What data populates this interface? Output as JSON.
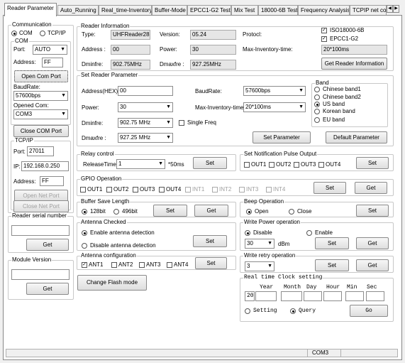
{
  "tabs": [
    "Reader Parameter",
    "Auto_Running",
    "Real_time-Inventory",
    "Buffer-Mode",
    "EPCC1-G2 Test",
    "Mix Test",
    "18000-6B Test",
    "Frequency Analysis",
    "TCPIP net co"
  ],
  "communication": {
    "title": "Communication",
    "com": "COM",
    "tcpip": "TCP/IP",
    "com_group": "COM",
    "port_label": "Port:",
    "port_value": "AUTO",
    "address_label": "Address:",
    "address_value": "FF",
    "open_com_port": "Open Com Port",
    "baudrate_label": "BaudRate:",
    "baudrate_value": "57600bps",
    "opened_com_label": "Opened Com:",
    "opened_com_value": "COM3",
    "close_com_port": "Close COM Port",
    "tcpip_group": "TCP/IP",
    "tport_label": "Port:",
    "tport_value": "27011",
    "ip_label": "IP:",
    "ip_value": "192.168.0.250",
    "taddress_label": "Address:",
    "taddress_value": "FF",
    "open_net_port": "Open Net Port",
    "close_net_port": "Close Net Port"
  },
  "serial": {
    "title": "Reader serial number",
    "get": "Get"
  },
  "module": {
    "title": "Module Version",
    "get": "Get"
  },
  "info": {
    "title": "Reader Information",
    "type_label": "Type:",
    "type_value": "UHFReader288",
    "version_label": "Version:",
    "version_value": "05.24",
    "protocol_label": "Protocl:",
    "iso_label": "ISO18000-6B",
    "epc_label": "EPCC1-G2",
    "address_label": "Address :",
    "address_value": "00",
    "power_label": "Power:",
    "power_value": "30",
    "maxinv_label": "Max-Inventory-time:",
    "maxinv_value": "20*100ms",
    "dminfre_label": "Dminfre:",
    "dminfre_value": "902.75MHz",
    "dmaxfre_label": "Dmaxfre :",
    "dmaxfre_value": "927.25MHz",
    "get_info": "Get Reader Information"
  },
  "setparam": {
    "title": "Set Reader Parameter",
    "address_label": "Address(HEX):",
    "address_value": "00",
    "baud_label": "BaudRate:",
    "baud_value": "57600bps",
    "power_label": "Power:",
    "power_value": "30",
    "maxinv_label": "Max-Inventory-time:",
    "maxinv_value": "20*100ms",
    "dminfre_label": "Dminfre:",
    "dminfre_value": "902.75 MHz",
    "single_freq": "Single Freq",
    "dmaxfre_label": "Dmaxfre :",
    "dmaxfre_value": "927.25 MHz",
    "set_param": "Set Parameter",
    "default_param": "Default Parameter",
    "band_title": "Band",
    "bands": [
      "Chinese band1",
      "Chinese band2",
      "US band",
      "Korean band",
      "EU band"
    ]
  },
  "relay": {
    "title": "Relay control",
    "label": "ReleaseTime",
    "value": "1",
    "unit": "*50ms",
    "set": "Set"
  },
  "notify": {
    "title": "Set Notification Pulse Output",
    "outs": [
      "OUT1",
      "OUT2",
      "OUT3",
      "OUT4"
    ],
    "set": "Set"
  },
  "gpio": {
    "title": "GPIO Operation",
    "outs": [
      "OUT1",
      "OUT2",
      "OUT3",
      "OUT4"
    ],
    "ints": [
      "INT1",
      "INT2",
      "INT3",
      "INT4"
    ],
    "set": "Set",
    "get": "Get"
  },
  "buffer": {
    "title": "Buffer Save Length",
    "opt1": "128bit",
    "opt2": "496bit",
    "set": "Set",
    "get": "Get"
  },
  "beep": {
    "title": "Beep Operation",
    "open": "Open",
    "close": "Close",
    "set": "Set"
  },
  "antenna_check": {
    "title": "Antenna Checked",
    "enable": "Enable antenna detection",
    "disable": "Disable antenna detection",
    "set": "Set"
  },
  "write_power": {
    "title": "Write Power operation",
    "disable": "Disable",
    "enable": "Enable",
    "value": "30",
    "unit": "dBm",
    "set": "Set",
    "get": "Get"
  },
  "antenna_config": {
    "title": "Antenna configuration",
    "ants": [
      "ANT1",
      "ANT2",
      "ANT3",
      "ANT4"
    ],
    "set": "Set"
  },
  "write_retry": {
    "title": "Write retry operation",
    "value": "3",
    "set": "Set",
    "get": "Get"
  },
  "flash": {
    "label": "Change Flash mode"
  },
  "rtc": {
    "title": "Real time Clock setting",
    "year": "Year",
    "month": "Month",
    "day": "Day",
    "hour": "Hour",
    "min": "Min",
    "sec": "Sec",
    "year_value": "20",
    "setting": "Setting",
    "query": "Query",
    "go": "Go"
  },
  "status": {
    "com": "COM3"
  }
}
